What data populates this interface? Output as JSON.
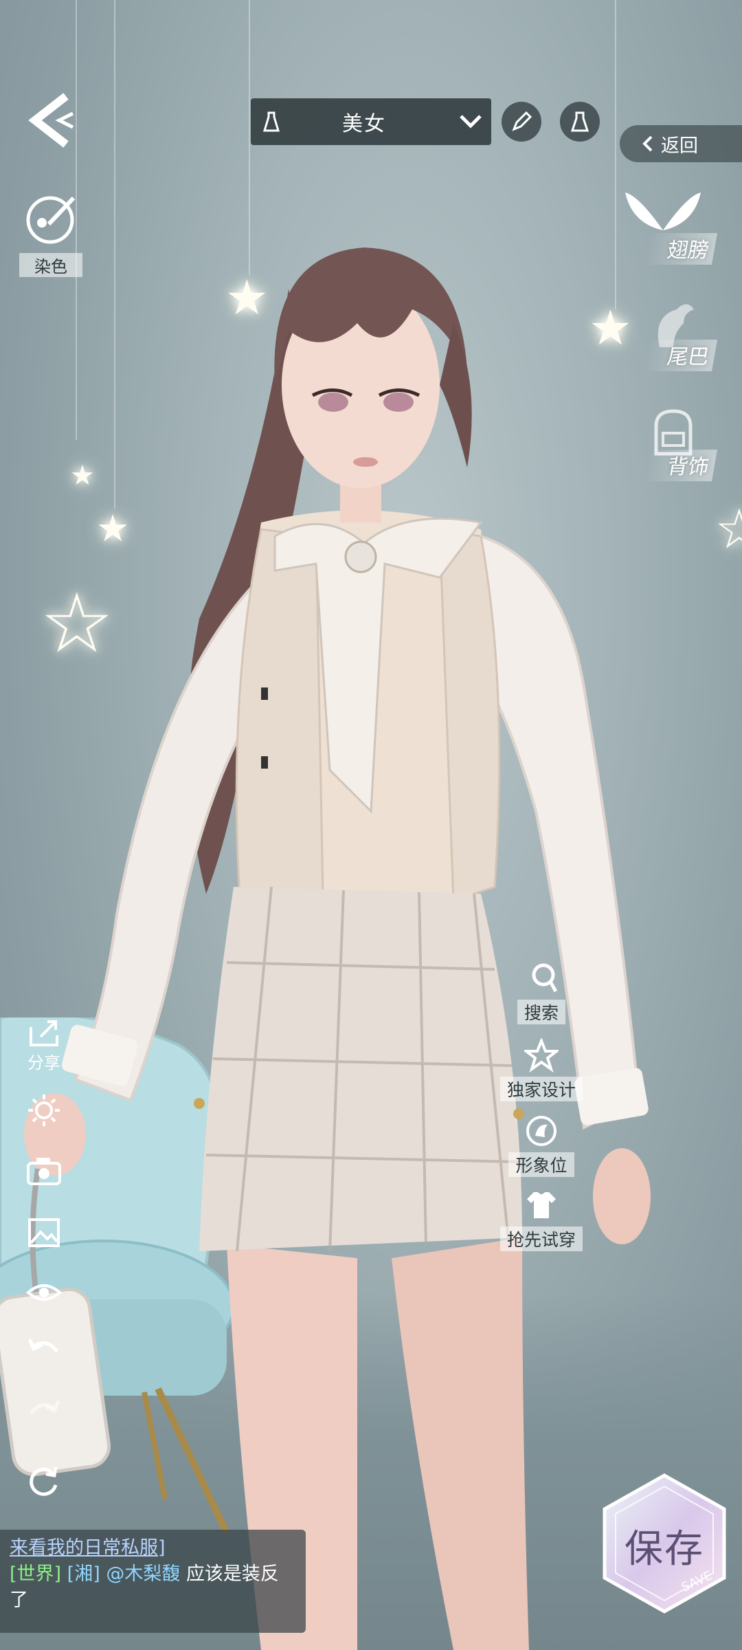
{
  "top_bar": {
    "preset_label": "美女",
    "return_label": "返回"
  },
  "left_panel": {
    "dye_label": "染色",
    "share_label": "分享"
  },
  "categories": [
    {
      "label": "翅膀",
      "icon": "wings-icon"
    },
    {
      "label": "尾巴",
      "icon": "tail-icon"
    },
    {
      "label": "背饰",
      "icon": "backpack-icon"
    }
  ],
  "actions": [
    {
      "label": "搜索",
      "icon": "search-icon"
    },
    {
      "label": "独家设计",
      "icon": "star-icon"
    },
    {
      "label": "形象位",
      "icon": "portrait-icon"
    },
    {
      "label": "抢先试穿",
      "icon": "shirt-icon"
    }
  ],
  "chat": {
    "topic": "来看我的日常私服]",
    "channel": "[世界]",
    "server": "[湘]",
    "user": "@木梨馥",
    "message": "应该是装反了"
  },
  "save": {
    "label": "保存",
    "sub": "SAVE"
  },
  "colors": {
    "background": "#a3b3b7",
    "panel": "#303a3e",
    "chat_channel": "#8df08a",
    "chat_user": "#8fd6ff"
  }
}
